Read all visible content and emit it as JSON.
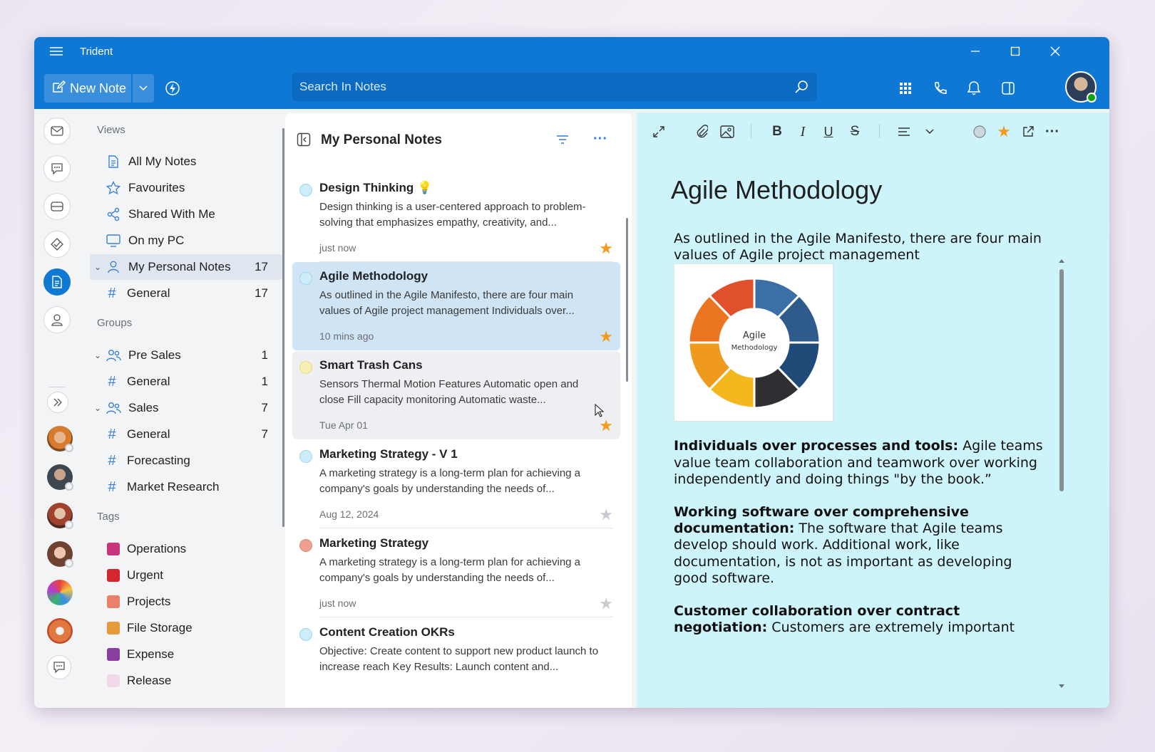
{
  "app": {
    "title": "Trident"
  },
  "toolbar": {
    "new_note_label": "New Note",
    "search_placeholder": "Search In Notes"
  },
  "nav": {
    "views_header": "Views",
    "views": [
      {
        "label": "All My Notes"
      },
      {
        "label": "Favourites"
      },
      {
        "label": "Shared With Me"
      },
      {
        "label": "On my PC"
      },
      {
        "label": "My Personal Notes",
        "count": "17"
      },
      {
        "label": "General",
        "count": "17"
      }
    ],
    "groups_header": "Groups",
    "groups": [
      {
        "label": "Pre Sales",
        "count": "1"
      },
      {
        "label": "General",
        "count": "1"
      },
      {
        "label": "Sales",
        "count": "7"
      },
      {
        "label": "General",
        "count": "7"
      },
      {
        "label": "Forecasting",
        "count": ""
      },
      {
        "label": "Market Research",
        "count": ""
      }
    ],
    "tags_header": "Tags",
    "tags": [
      {
        "label": "Operations",
        "color": "#c8357a"
      },
      {
        "label": "Urgent",
        "color": "#d4262e"
      },
      {
        "label": "Projects",
        "color": "#e8806a"
      },
      {
        "label": "File Storage",
        "color": "#e69a3a"
      },
      {
        "label": "Expense",
        "color": "#8a3fa0"
      },
      {
        "label": "Release",
        "color": "#f2d9ea"
      }
    ]
  },
  "list": {
    "title": "My Personal Notes",
    "notes": [
      {
        "title": "Design Thinking",
        "preview": "Design thinking is a user-centered approach to problem-solving that emphasizes empathy, creativity, and...",
        "date": "just now",
        "color": "#cdeef9",
        "starred": true
      },
      {
        "title": "Agile Methodology",
        "preview": "As outlined in the Agile Manifesto, there are four main values of Agile project management Individuals over...",
        "date": "10 mins ago",
        "color": "#cdeef9",
        "starred": true
      },
      {
        "title": "Smart Trash Cans",
        "preview": "Sensors Thermal Motion Features Automatic open and close Fill capacity monitoring Automatic waste...",
        "date": "Tue Apr 01",
        "color": "#f7efb8",
        "starred": true
      },
      {
        "title": "Marketing Strategy - V 1",
        "preview": "A marketing strategy is a long-term plan for achieving a company's goals by understanding the needs of...",
        "date": "Aug 12, 2024",
        "color": "#cdeef9",
        "starred": false
      },
      {
        "title": "Marketing Strategy",
        "preview": "A marketing strategy is a long-term plan for achieving a company's goals by understanding the needs of...",
        "date": "just now",
        "color": "#ee9f8f",
        "starred": false
      },
      {
        "title": "Content Creation OKRs",
        "preview": "Objective: Create content to support new product launch to increase reach Key Results: Launch content and...",
        "date": "",
        "color": "#cdeef9",
        "starred": false
      }
    ]
  },
  "editor": {
    "title": "Agile Methodology",
    "intro": "As outlined in the Agile Manifesto, there are four main values of Agile project management",
    "image_title": "Agile Methodology",
    "paragraphs": [
      {
        "bold": "Individuals over processes and tools:",
        "text": " Agile teams value team collaboration and teamwork over working independently and doing things \"by the book.”"
      },
      {
        "bold": "Working software over comprehensive documentation:",
        "text": " The software that Agile teams develop should work. Additional work, like documentation, is not as important as developing good software."
      },
      {
        "bold": "Customer collaboration over contract negotiation:",
        "text": " Customers are extremely important"
      }
    ]
  },
  "colors": {
    "accent": "#0f78d4",
    "star_on": "#f29b1d",
    "star_off": "#c9ccd2",
    "editor_bg": "#cdf4fb"
  }
}
